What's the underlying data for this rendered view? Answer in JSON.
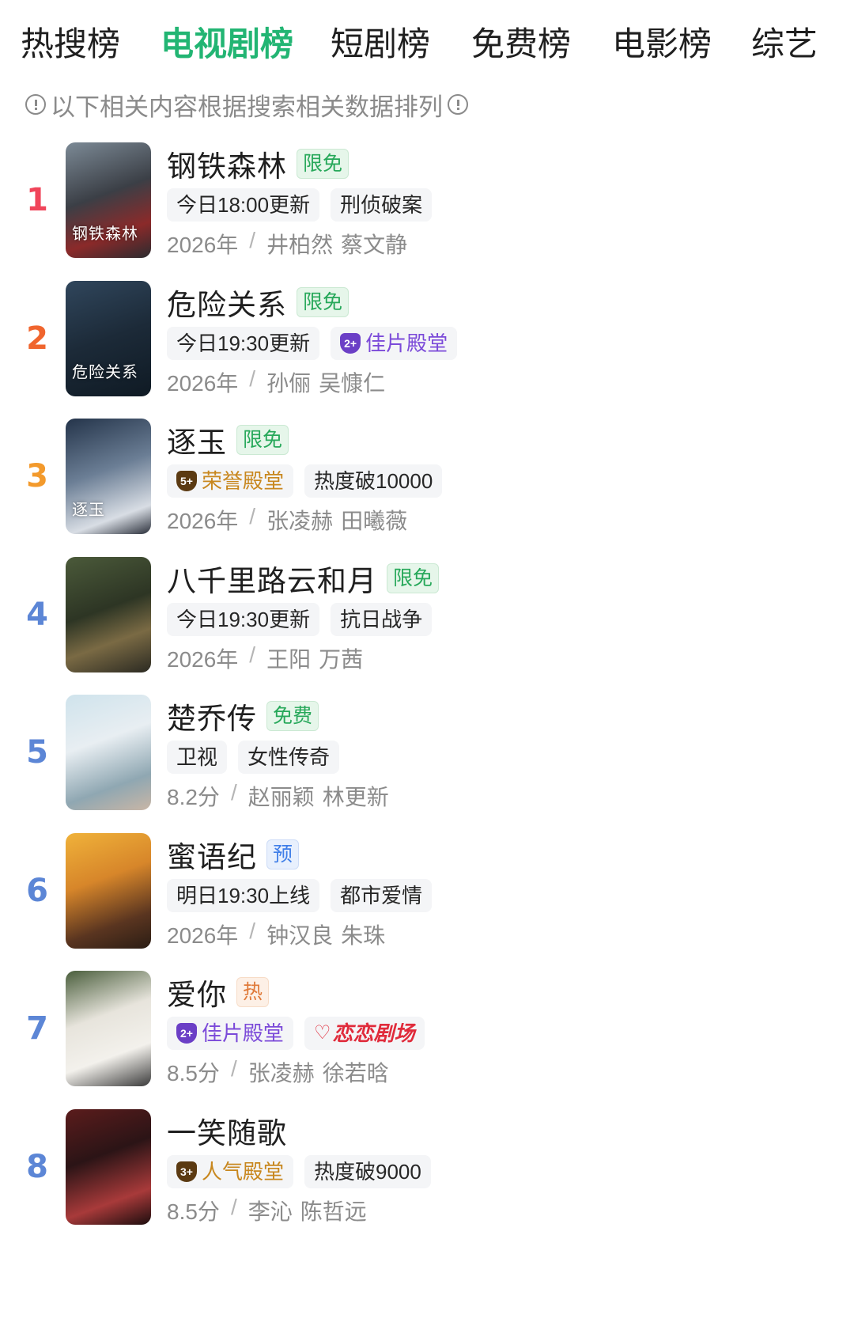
{
  "tabs": [
    {
      "label": "热搜榜",
      "active": false
    },
    {
      "label": "电视剧榜",
      "active": true
    },
    {
      "label": "短剧榜",
      "active": false
    },
    {
      "label": "免费榜",
      "active": false
    },
    {
      "label": "电影榜",
      "active": false
    },
    {
      "label": "综艺",
      "active": false
    }
  ],
  "notice": "以下相关内容根据搜索相关数据排列",
  "colors": {
    "accent": "#22b573",
    "rank1": "#f0455a",
    "rank2": "#f0652e",
    "rank3": "#f39a2c",
    "rank_other": "#5c86d6"
  },
  "items": [
    {
      "rank": "1",
      "title": "钢铁森林",
      "badge": "限免",
      "badge_color": "green",
      "tags": [
        {
          "text": "今日18:00更新",
          "style": "plain"
        },
        {
          "text": "刑侦破案",
          "style": "plain"
        }
      ],
      "meta": "2026年",
      "actors": [
        "井柏然",
        "蔡文静"
      ],
      "poster_text": "钢铁森林"
    },
    {
      "rank": "2",
      "title": "危险关系",
      "badge": "限免",
      "badge_color": "green",
      "tags": [
        {
          "text": "今日19:30更新",
          "style": "plain"
        },
        {
          "text": "佳片殿堂",
          "style": "purple",
          "icon_text": "2+"
        }
      ],
      "meta": "2026年",
      "actors": [
        "孙俪",
        "吴慷仁"
      ],
      "poster_text": "危险关系"
    },
    {
      "rank": "3",
      "title": "逐玉",
      "badge": "限免",
      "badge_color": "green",
      "tags": [
        {
          "text": "荣誉殿堂",
          "style": "gold",
          "icon_text": "5+"
        },
        {
          "text": "热度破10000",
          "style": "plain"
        }
      ],
      "meta": "2026年",
      "actors": [
        "张凌赫",
        "田曦薇"
      ],
      "poster_text": "逐玉"
    },
    {
      "rank": "4",
      "title": "八千里路云和月",
      "badge": "限免",
      "badge_color": "green",
      "tags": [
        {
          "text": "今日19:30更新",
          "style": "plain"
        },
        {
          "text": "抗日战争",
          "style": "plain"
        }
      ],
      "meta": "2026年",
      "actors": [
        "王阳",
        "万茜"
      ],
      "poster_text": ""
    },
    {
      "rank": "5",
      "title": "楚乔传",
      "badge": "免费",
      "badge_color": "green",
      "tags": [
        {
          "text": "卫视",
          "style": "plain"
        },
        {
          "text": "女性传奇",
          "style": "plain"
        }
      ],
      "meta": "8.2分",
      "actors": [
        "赵丽颖",
        "林更新"
      ],
      "poster_text": ""
    },
    {
      "rank": "6",
      "title": "蜜语纪",
      "badge": "预",
      "badge_color": "blue",
      "tags": [
        {
          "text": "明日19:30上线",
          "style": "plain"
        },
        {
          "text": "都市爱情",
          "style": "plain"
        }
      ],
      "meta": "2026年",
      "actors": [
        "钟汉良",
        "朱珠"
      ],
      "poster_text": ""
    },
    {
      "rank": "7",
      "title": "爱你",
      "badge": "热",
      "badge_color": "orange",
      "tags": [
        {
          "text": "佳片殿堂",
          "style": "purple",
          "icon_text": "2+"
        },
        {
          "text": "恋恋剧场",
          "style": "red"
        }
      ],
      "meta": "8.5分",
      "actors": [
        "张凌赫",
        "徐若晗"
      ],
      "poster_text": ""
    },
    {
      "rank": "8",
      "title": "一笑随歌",
      "badge": "",
      "badge_color": "none",
      "tags": [
        {
          "text": "人气殿堂",
          "style": "gold",
          "icon_text": "3+"
        },
        {
          "text": "热度破9000",
          "style": "plain"
        }
      ],
      "meta": "8.5分",
      "actors": [
        "李沁",
        "陈哲远"
      ],
      "poster_text": ""
    }
  ]
}
